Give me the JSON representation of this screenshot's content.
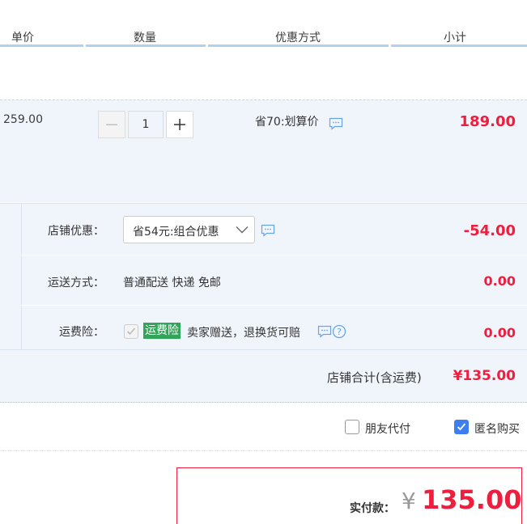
{
  "header": {
    "col_unit_price": "单价",
    "col_quantity": "数量",
    "col_discount": "优惠方式",
    "col_subtotal": "小计"
  },
  "item": {
    "unit_price": "259.00",
    "quantity": "1",
    "discount_text": "省70:划算价",
    "subtotal": "189.00"
  },
  "shop": {
    "promo_label": "店铺优惠：",
    "promo_selected": "省54元:组合优惠",
    "promo_amount": "-54.00",
    "shipping_label": "运送方式：",
    "shipping_value": "普通配送 快递 免邮",
    "shipping_amount": "0.00",
    "insurance_label": "运费险：",
    "insurance_badge": "运费险",
    "insurance_text": "卖家赠送，退换货可赔",
    "insurance_amount": "0.00",
    "total_label": "店铺合计(含运费)",
    "total_value": "¥135.00"
  },
  "options": {
    "friend_pay": "朋友代付",
    "friend_pay_checked": false,
    "anonymous": "匿名购买",
    "anonymous_checked": true
  },
  "payment": {
    "label": "实付款：",
    "currency": "¥",
    "amount": "135.00"
  },
  "colors": {
    "accent_red": "#ee1f3e",
    "header_line": "#b2d1f0",
    "row_bg": "#f0f5fc",
    "checkbox_blue": "#3d7ff0",
    "insurance_badge_bg": "#31a658"
  }
}
